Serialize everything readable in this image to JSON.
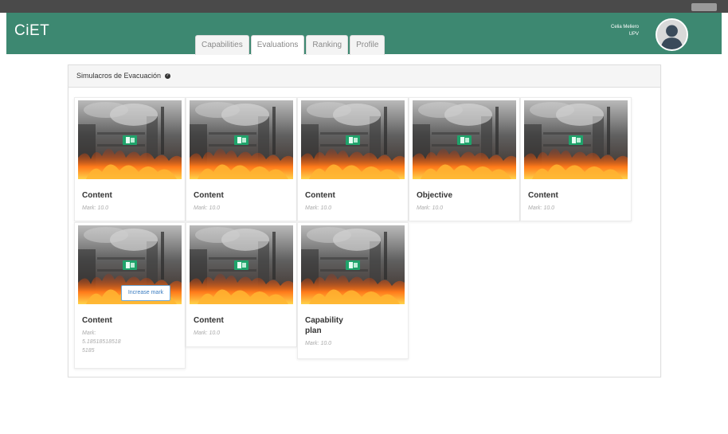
{
  "app": {
    "brand": "CiET"
  },
  "nav": {
    "tabs": [
      {
        "label": "Capabilities",
        "active": false
      },
      {
        "label": "Evaluations",
        "active": true
      },
      {
        "label": "Ranking",
        "active": false
      },
      {
        "label": "Profile",
        "active": false
      }
    ]
  },
  "user": {
    "name": "Celia Meliero",
    "org": "UPV"
  },
  "panel": {
    "title": "Simulacros de Evacuación"
  },
  "cards": [
    {
      "title": "Content",
      "mark": "Mark: 10.0"
    },
    {
      "title": "Content",
      "mark": "Mark: 10.0"
    },
    {
      "title": "Content",
      "mark": "Mark: 10.0"
    },
    {
      "title": "Objective",
      "mark": "Mark: 10.0"
    },
    {
      "title": "Content",
      "mark": "Mark: 10.0"
    },
    {
      "title": "Content",
      "mark_label": "Mark:",
      "mark_value_1": "5.18518518518",
      "mark_value_2": "5185",
      "button": "Increase mark"
    },
    {
      "title": "Content",
      "mark": "Mark: 10.0"
    },
    {
      "title_1": "Capability",
      "title_2": "plan",
      "mark": "Mark: 10.0"
    }
  ],
  "colors": {
    "navbar": "#3d8871",
    "button_border": "#6fa7d6"
  }
}
